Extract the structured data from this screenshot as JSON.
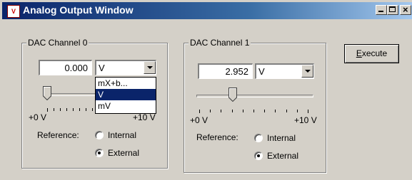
{
  "window": {
    "title": "Analog Output Window",
    "icon_text": "V"
  },
  "titlebar_buttons": [
    "minimize-icon",
    "maximize-icon",
    "close-icon"
  ],
  "close_glyph": "×",
  "channel0": {
    "label": "DAC Channel 0",
    "value": "0.000",
    "unit_selected": "V",
    "dropdown_open": true,
    "dropdown_options": [
      "mX+b...",
      "V",
      "mV"
    ],
    "dropdown_selected_index": 1,
    "slider_fraction": 0.0,
    "scale_min": "+0 V",
    "scale_max": "+10 V",
    "reference_label": "Reference:",
    "options": [
      "Internal",
      "External"
    ],
    "selected_option": "External"
  },
  "channel1": {
    "label": "DAC Channel 1",
    "value": "2.952",
    "unit_selected": "V",
    "slider_fraction": 0.2952,
    "scale_min": "+0 V",
    "scale_max": "+10 V",
    "reference_label": "Reference:",
    "options": [
      "Internal",
      "External"
    ],
    "selected_option": "External"
  },
  "execute_button": {
    "mnemonic": "E",
    "rest": "xecute"
  },
  "colors": {
    "titlebar_start": "#0a246a",
    "titlebar_end": "#a6caf0",
    "face": "#d4d0c8",
    "selection": "#0a246a"
  }
}
